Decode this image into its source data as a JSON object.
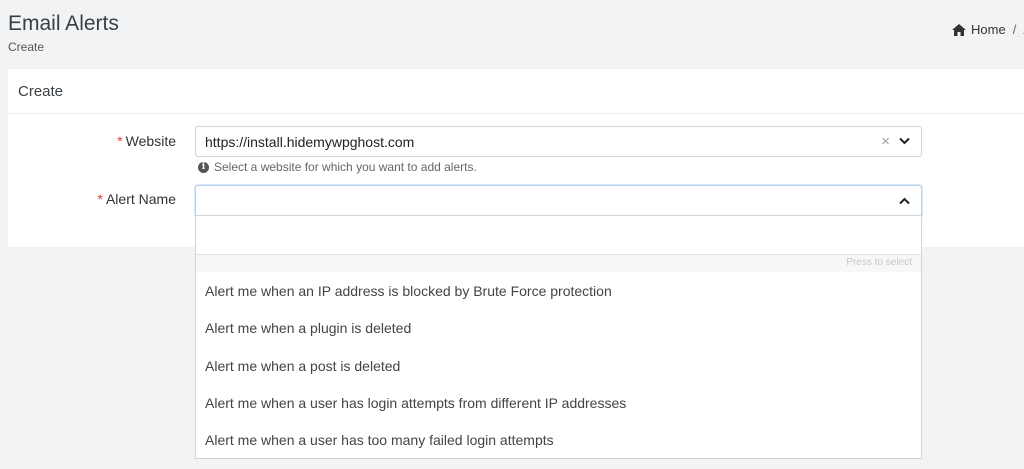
{
  "header": {
    "title": "Email Alerts",
    "subtitle": "Create",
    "breadcrumb": [
      "Home",
      "/",
      "A"
    ]
  },
  "card": {
    "title": "Create"
  },
  "form": {
    "website": {
      "required_mark": "*",
      "label": "Website",
      "value": "https://install.hidemywpghost.com",
      "clear_glyph": "×",
      "help": "Select a website for which you want to add alerts."
    },
    "alert_name": {
      "required_mark": "*",
      "label": "Alert Name",
      "value": "",
      "search_value": "",
      "hint": "Press to select",
      "options": [
        "Alert me when an IP address is blocked by Brute Force protection",
        "Alert me when a plugin is deleted",
        "Alert me when a post is deleted",
        "Alert me when a user has login attempts from different IP addresses",
        "Alert me when a user has too many failed login attempts"
      ]
    }
  },
  "icons": {
    "home": "home-icon",
    "info": "info-circle-icon",
    "chevron_down": "chevron-down-icon",
    "chevron_up": "chevron-up-icon",
    "clear": "close-icon"
  },
  "colors": {
    "required": "#e53935",
    "focus_border": "#b5d3ef",
    "background": "#f2f3f5"
  }
}
